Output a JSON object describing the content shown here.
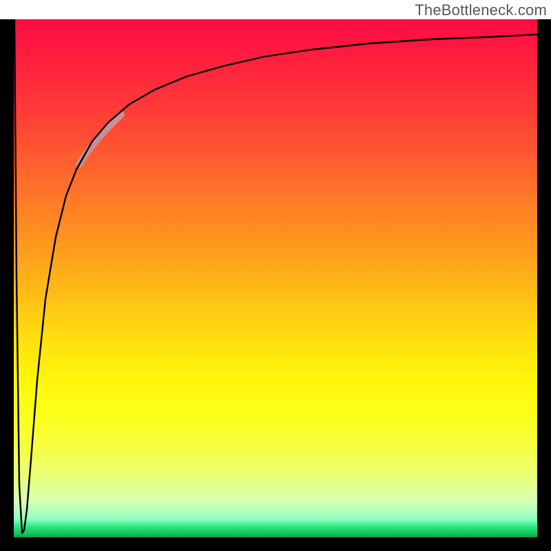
{
  "watermark": "TheBottleneck.com",
  "chart_data": {
    "type": "line",
    "title": "",
    "xlabel": "",
    "ylabel": "",
    "xlim": [
      0,
      100
    ],
    "ylim": [
      0,
      100
    ],
    "grid": false,
    "legend": false,
    "series": [
      {
        "name": "curve",
        "x": [
          0,
          0.5,
          1.0,
          1.5,
          2.0,
          2.5,
          3.3,
          4.5,
          6.0,
          8.0,
          10.0,
          12.0,
          15.0,
          18.0,
          22.0,
          27.0,
          33.0,
          40.0,
          48.0,
          57.0,
          68.0,
          80.0,
          90.0,
          100.0
        ],
        "y": [
          100,
          50,
          10,
          0.5,
          1.0,
          5.0,
          15.0,
          30.0,
          46.0,
          58.0,
          66.0,
          71.0,
          76.5,
          80.0,
          83.5,
          86.5,
          89.0,
          91.0,
          92.8,
          94.2,
          95.3,
          96.1,
          96.6,
          97.0
        ]
      },
      {
        "name": "highlight",
        "x": [
          12.5,
          13.4,
          14.3,
          15.2,
          16.1,
          17.0,
          17.9,
          18.8,
          19.7,
          20.5
        ],
        "y": [
          72.0,
          73.4,
          74.7,
          75.9,
          77.0,
          78.0,
          79.0,
          79.9,
          80.8,
          81.6
        ]
      }
    ],
    "colors": {
      "curve": "#000000",
      "highlight": "#c98d94",
      "gradient_top": "#ff0b42",
      "gradient_bottom": "#0fa64c"
    }
  }
}
